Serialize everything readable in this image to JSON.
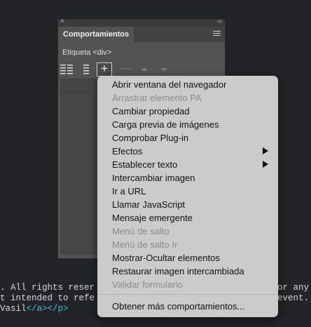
{
  "code": {
    "line1_left": ". All rights reser",
    "line1_right": "or any",
    "line2_left": "t intended to refe",
    "line2_right": "event.",
    "line3_text": "Vasil",
    "line3_tag": "</a></p>"
  },
  "panel": {
    "close_glyph": "×",
    "collapse_glyph": "‹‹",
    "tab_label": "Comportamientos",
    "tag_label": "Etiqueta <div>",
    "add_glyph": "+",
    "remove_glyph": "—"
  },
  "menu": {
    "items": [
      {
        "label": "Abrir ventana del navegador",
        "enabled": true
      },
      {
        "label": "Arrastrar elemento PA",
        "enabled": false
      },
      {
        "label": "Cambiar propiedad",
        "enabled": true
      },
      {
        "label": "Carga previa de imágenes",
        "enabled": true
      },
      {
        "label": "Comprobar Plug-in",
        "enabled": true
      },
      {
        "label": "Efectos",
        "enabled": true,
        "submenu": true
      },
      {
        "label": "Establecer texto",
        "enabled": true,
        "submenu": true
      },
      {
        "label": "Intercambiar imagen",
        "enabled": true
      },
      {
        "label": "Ir a URL",
        "enabled": true
      },
      {
        "label": "Llamar JavaScript",
        "enabled": true
      },
      {
        "label": "Mensaje emergente",
        "enabled": true
      },
      {
        "label": "Menú de salto",
        "enabled": false
      },
      {
        "label": "Menú de salto Ir",
        "enabled": false
      },
      {
        "label": "Mostrar-Ocultar elementos",
        "enabled": true
      },
      {
        "label": "Restaurar imagen intercambiada",
        "enabled": true
      },
      {
        "label": "Validar formulario",
        "enabled": false
      }
    ],
    "footer_item": "Obtener más comportamientos..."
  }
}
